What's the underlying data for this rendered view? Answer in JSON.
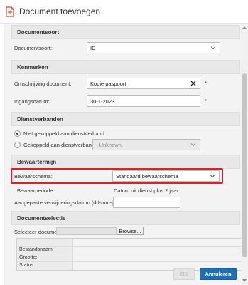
{
  "window": {
    "title": "Document toevoegen"
  },
  "sections": {
    "documentsoort": {
      "header": "Documentsoort",
      "label": "Documentsoort::",
      "value": "ID"
    },
    "kenmerken": {
      "header": "Kenmerken",
      "omschrijving_label": "Omschrijving document:",
      "omschrijving_value": "Kopie paspoort",
      "ingangsdatum_label": "Ingangsdatum:",
      "ingangsdatum_value": "30-1-2023",
      "required_mark": "*"
    },
    "dienstverbanden": {
      "header": "Dienstverbanden",
      "option_not_linked": "Niet gekoppeld aan dienstverband:",
      "option_linked": "Gekoppeld aan dienstverband:",
      "linked_select_value": "- Unknown,"
    },
    "bewaartermijn": {
      "header": "Bewaartermijn",
      "schema_label": "Bewaarschema:",
      "schema_value": "Standaard bewaarschema",
      "periode_label": "Bewaarperiode:",
      "periode_value": "Datum uit dienst plus 2 jaar",
      "aangepaste_label": "Aangepaste verwijderingsdatum (dd-mm-jjjj):",
      "aangepaste_value": ""
    },
    "documentselectie": {
      "header": "Documentselectie",
      "select_label": "Selecteer document",
      "browse_label": "Browse...",
      "info_rows": [
        {
          "label": ""
        },
        {
          "label": "Bestandsnaam:"
        },
        {
          "label": "Grootte:"
        },
        {
          "label": "Status:"
        }
      ]
    }
  },
  "footer": {
    "ok_label": "OK",
    "cancel_label": "Annuleren"
  },
  "colors": {
    "accent": "#1d6fb8",
    "highlight": "#d9232a",
    "icon": "#e0452f"
  }
}
